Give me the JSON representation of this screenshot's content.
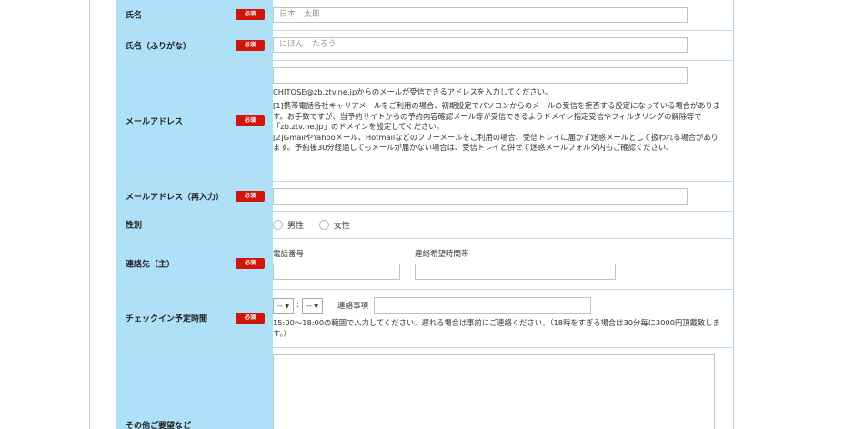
{
  "required_badge": "必須",
  "rows": {
    "name": {
      "label": "氏名",
      "placeholder": "日本　太郎"
    },
    "kana": {
      "label": "氏名（ふりがな）",
      "placeholder": "にほん　たろう"
    },
    "email": {
      "label": "メールアドレス",
      "note1": "CHITOSE@zb.ztv.ne.jpからのメールが受信できるアドレスを入力してください。",
      "note2": "[1]携帯電話各社キャリアメールをご利用の場合、初期設定でパソコンからのメールの受信を拒否する設定になっている場合があります。お手数ですが、当予約サイトからの予約内容確認メール等が受信できるようドメイン指定受信やフィルタリングの解除等で「zb.ztv.ne.jp」のドメインを設定してください。",
      "note3": "[2]GmailやYahooメール、Hotmailなどのフリーメールをご利用の場合、受信トレイに届かず迷惑メールとして扱われる場合があります。予約後30分経過してもメールが届かない場合は、受信トレイと併せて迷惑メールフォルダ内もご確認ください。"
    },
    "email_confirm": {
      "label": "メールアドレス（再入力）"
    },
    "gender": {
      "label": "性別",
      "options": [
        "男性",
        "女性"
      ]
    },
    "contact": {
      "label": "連絡先（主）",
      "phone_label": "電話番号",
      "time_label": "連絡希望時間帯"
    },
    "checkin": {
      "label": "チェックイン予定時間",
      "hour": "--",
      "sep": ":",
      "minute": "--",
      "remarks_label": "連絡事項",
      "note": "15:00～18:00の範囲で入力してください。遅れる場合は事前にご連絡ください。（18時をすぎる場合は30分毎に3000円頂戴致します。）"
    },
    "requests": {
      "label": "その他ご要望など"
    }
  }
}
